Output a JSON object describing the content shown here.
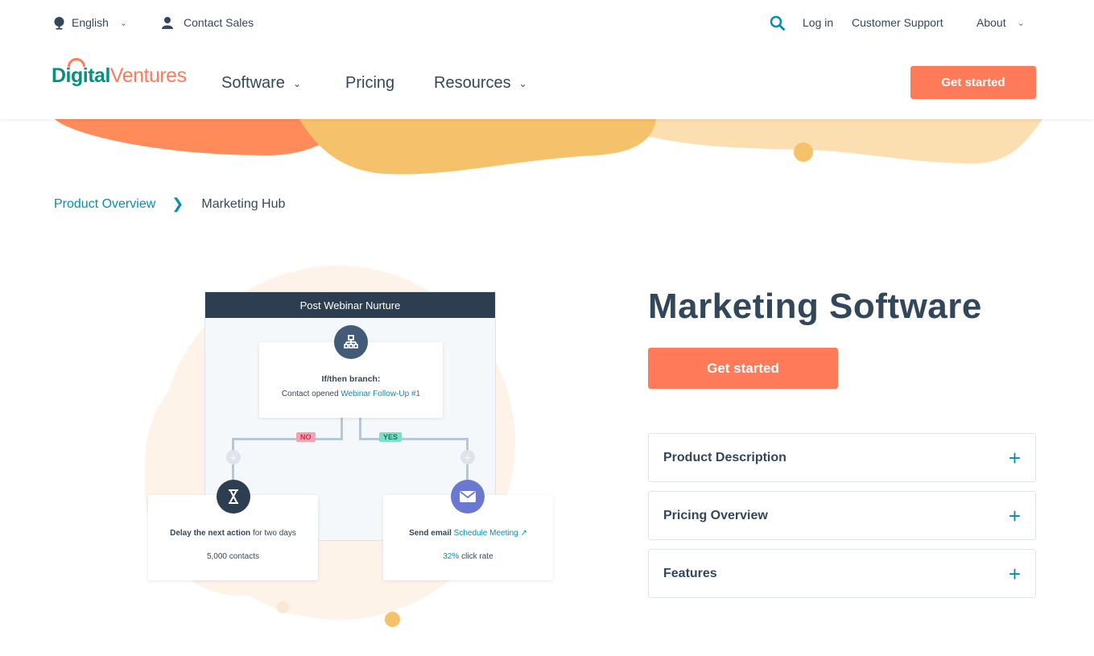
{
  "utility_bar": {
    "language": "English",
    "contact": "Contact Sales",
    "login": "Log in",
    "support": "Customer Support",
    "about": "About"
  },
  "header": {
    "logo_part1": "Digital",
    "logo_part2": "Ventures",
    "nav": {
      "software": "Software",
      "pricing": "Pricing",
      "resources": "Resources"
    },
    "cta": "Get started"
  },
  "breadcrumb": {
    "parent": "Product Overview",
    "current": "Marketing Hub"
  },
  "illustration": {
    "workflow_title": "Post Webinar Nurture",
    "branch_title": "If/then branch:",
    "branch_text": "Contact opened",
    "branch_link": "Webinar Follow-Up #1",
    "no_label": "NO",
    "yes_label": "YES",
    "delay_bold": "Delay the next action",
    "delay_rest": "for two days",
    "delay_count": "5,000 contacts",
    "email_bold": "Send email",
    "email_link": "Schedule Meeting",
    "click_rate_value": "32%",
    "click_rate_label": "click rate"
  },
  "product": {
    "title": "Marketing Software",
    "cta": "Get started",
    "accordion": [
      {
        "label": "Product Description"
      },
      {
        "label": "Pricing Overview"
      },
      {
        "label": "Features"
      }
    ]
  },
  "colors": {
    "accent": "#ff7a59",
    "teal": "#0091ae",
    "text": "#33475b",
    "dark_header": "#2d3e50"
  }
}
